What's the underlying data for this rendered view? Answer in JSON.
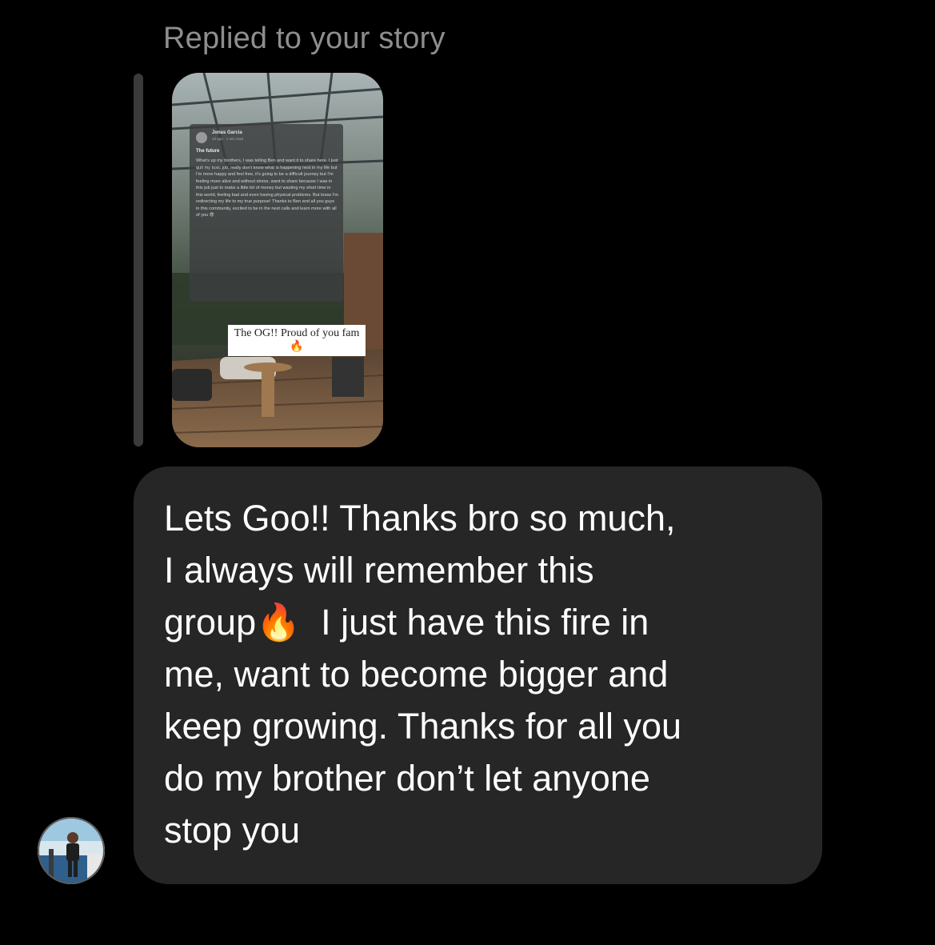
{
  "reply_header": {
    "label": "Replied to your story"
  },
  "story_preview": {
    "post": {
      "author": "Jonas Garcia",
      "meta": "1d ago · 1 min read",
      "heading": "The future",
      "body": "What's up my brothers, I was telling Ben and want it to share here. I just quit my toxic job, really don't know what is happening next in my life but I'm more happy and feel free, it's going to be a difficult journey but I'm feeling more alive and without stress, want to share because I was in this job just to make a little bit of money but wasting my short time in this world, feeling bad and even having physical problems. But know I'm redirecting my life to my true purpose! Thanks to Ben and all you guys in this community, excited to be in the next calls and learn more with all of you 😎"
    },
    "sticker_text": "The OG!! Proud of you fam 🔥"
  },
  "message": {
    "text": "Lets Goo!! Thanks bro so much,\nI always will remember this\ngroup🔥  I just have this fire in\nme, want to become bigger and\nkeep growing. Thanks for all you\ndo my brother don’t let anyone\nstop you"
  },
  "colors": {
    "background": "#000000",
    "bubble": "#262626",
    "muted_text": "#8e8e8e",
    "reply_bar": "#3a3a3a"
  },
  "icons": {
    "sender_avatar": "profile-photo"
  }
}
